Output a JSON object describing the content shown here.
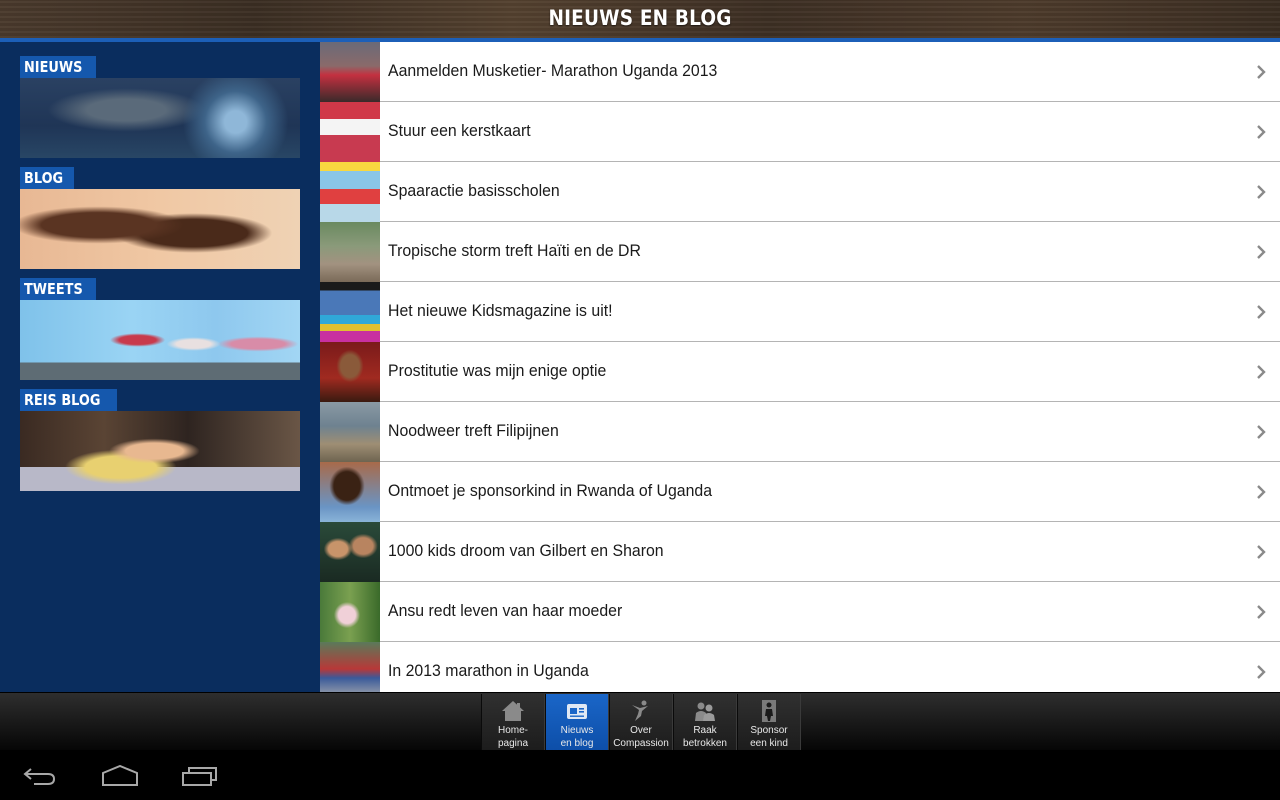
{
  "header": {
    "title": "NIEUWS EN BLOG"
  },
  "sidebar": {
    "items": [
      {
        "label": "NIEUWS",
        "image": "nieuws-image"
      },
      {
        "label": "BLOG",
        "image": "blog-image"
      },
      {
        "label": "TWEETS",
        "image": "tweets-image"
      },
      {
        "label": "REIS BLOG",
        "image": "reis-blog-image"
      }
    ]
  },
  "list": {
    "items": [
      {
        "title": "Aanmelden Musketier- Marathon Uganda 2013"
      },
      {
        "title": "Stuur een kerstkaart"
      },
      {
        "title": "Spaaractie basisscholen"
      },
      {
        "title": "Tropische storm treft Haïti en de DR"
      },
      {
        "title": "Het nieuwe Kidsmagazine is uit!"
      },
      {
        "title": "Prostitutie was mijn enige optie"
      },
      {
        "title": "Noodweer treft Filipijnen"
      },
      {
        "title": "Ontmoet je sponsorkind in Rwanda of Uganda"
      },
      {
        "title": "1000 kids droom van Gilbert en Sharon"
      },
      {
        "title": "Ansu redt leven van haar moeder"
      },
      {
        "title": "In 2013 marathon in Uganda"
      }
    ],
    "chevron_icon": "chevron-right-icon"
  },
  "tabbar": {
    "tabs": [
      {
        "label": "Home-\npagina",
        "icon": "home-icon",
        "active": false
      },
      {
        "label": "Nieuws\nen blog",
        "icon": "newspaper-icon",
        "active": true
      },
      {
        "label": "Over\nCompassion",
        "icon": "jumping-person-icon",
        "active": false
      },
      {
        "label": "Raak\nbetrokken",
        "icon": "people-icon",
        "active": false
      },
      {
        "label": "Sponsor\neen kind",
        "icon": "child-icon",
        "active": false
      }
    ]
  },
  "navbar": {
    "buttons": [
      "back-icon",
      "home-icon",
      "recent-apps-icon"
    ]
  },
  "colors": {
    "accent": "#1558ad",
    "sidebar_bg": "#0a2d5e",
    "active_tab": "#1a66c8"
  }
}
